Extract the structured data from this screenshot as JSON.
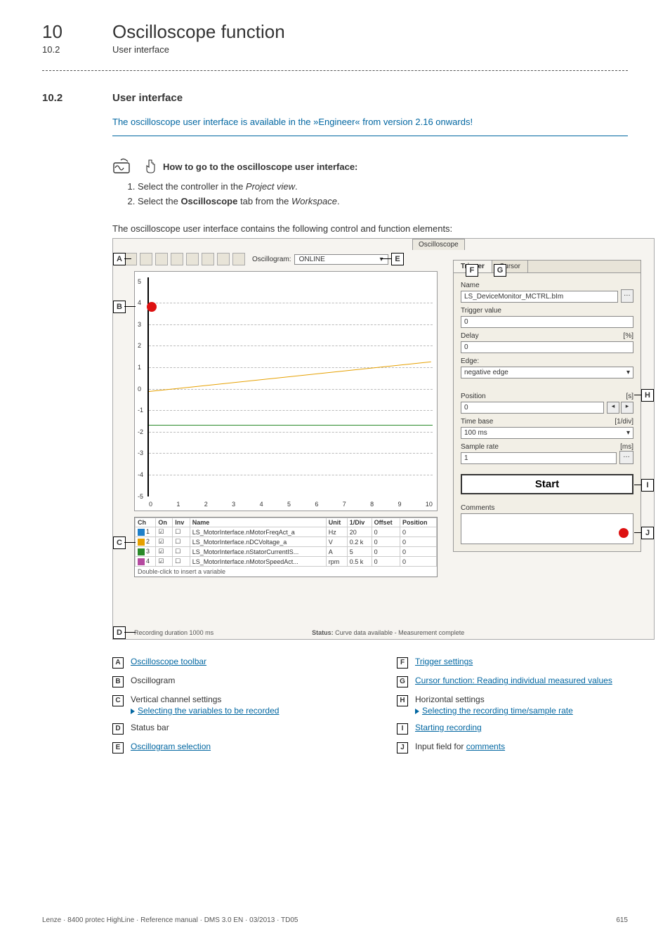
{
  "header": {
    "chapter_num": "10",
    "chapter_title": "Oscilloscope function",
    "sub_num": "10.2",
    "sub_title": "User interface"
  },
  "section": {
    "num": "10.2",
    "title": "User interface",
    "info_banner": "The oscilloscope user interface is available in the »Engineer« from version 2.16 onwards!",
    "howto_title": "How to go to the oscilloscope user interface:",
    "steps": {
      "s1a": "Select the controller in the ",
      "s1b": "Project view",
      "s1c": ".",
      "s2a": "Select the ",
      "s2b": "Oscilloscope",
      "s2c": " tab from the ",
      "s2d": "Workspace",
      "s2e": "."
    },
    "intro_text": "The oscilloscope user interface contains the following control and function elements:"
  },
  "screenshot": {
    "tab_label": "Oscilloscope",
    "toolbar": {
      "oscillogram_label": "Oscillogram:",
      "oscillogram_value": "ONLINE"
    },
    "y_ticks": [
      "5",
      "4",
      "3",
      "2",
      "1",
      "0",
      "-1",
      "-2",
      "-3",
      "-4",
      "-5"
    ],
    "x_ticks": [
      "0",
      "1",
      "2",
      "3",
      "4",
      "5",
      "6",
      "7",
      "8",
      "9",
      "10"
    ],
    "channels": {
      "headers": [
        "Ch",
        "On",
        "Inv",
        "Name",
        "Unit",
        "1/Div",
        "Offset",
        "Position"
      ],
      "rows": [
        {
          "ch": "1",
          "color": "#1e7fc9",
          "name": "LS_MotorInterface.nMotorFreqAct_a",
          "unit": "Hz",
          "div": "20",
          "offset": "0",
          "pos": "0"
        },
        {
          "ch": "2",
          "color": "#e6a000",
          "name": "LS_MotorInterface.nDCVoltage_a",
          "unit": "V",
          "div": "0.2 k",
          "offset": "0",
          "pos": "0"
        },
        {
          "ch": "3",
          "color": "#2a8a2a",
          "name": "LS_MotorInterface.nStatorCurrentIS...",
          "unit": "A",
          "div": "5",
          "offset": "0",
          "pos": "0"
        },
        {
          "ch": "4",
          "color": "#b54aa0",
          "name": "LS_MotorInterface.nMotorSpeedAct...",
          "unit": "rpm",
          "div": "0.5 k",
          "offset": "0",
          "pos": "0"
        }
      ],
      "hint": "Double-click to insert a variable"
    },
    "status": {
      "recording": "Recording duration 1000 ms",
      "status_label": "Status:",
      "status_text": "Curve data available - Measurement complete"
    },
    "side": {
      "tab_trigger": "Trigger",
      "tab_cursor": "Cursor",
      "name_label": "Name",
      "name_value": "LS_DeviceMonitor_MCTRL.bIm",
      "trigger_value_label": "Trigger value",
      "trigger_value": "0",
      "delay_label": "Delay",
      "delay_unit": "[%]",
      "delay_value": "0",
      "edge_label": "Edge:",
      "edge_value": "negative edge",
      "position_label": "Position",
      "position_unit": "[s]",
      "position_value": "0",
      "timebase_label": "Time base",
      "timebase_unit": "[1/div]",
      "timebase_value": "100 ms",
      "samplerate_label": "Sample rate",
      "samplerate_unit": "[ms]",
      "samplerate_value": "1",
      "start_button": "Start",
      "comments_label": "Comments"
    }
  },
  "legend": {
    "A": {
      "text": "Oscilloscope toolbar"
    },
    "B": {
      "text": "Oscillogram"
    },
    "C": {
      "text": "Vertical channel settings",
      "sublink": "Selecting the variables to be recorded"
    },
    "D": {
      "text": "Status bar"
    },
    "E": {
      "text": "Oscillogram selection"
    },
    "F": {
      "text": "Trigger settings"
    },
    "G": {
      "text": "Cursor function: Reading individual measured values"
    },
    "H": {
      "text": "Horizontal settings",
      "sublink": "Selecting the recording time/sample rate"
    },
    "I": {
      "text": "Starting recording"
    },
    "J": {
      "prefix": "Input field for ",
      "link": "comments"
    }
  },
  "footer": {
    "left": "Lenze · 8400 protec HighLine · Reference manual · DMS 3.0 EN · 03/2013 · TD05",
    "right": "615"
  }
}
